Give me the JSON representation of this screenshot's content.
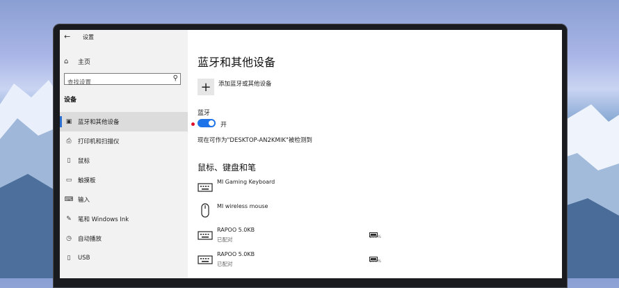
{
  "window": {
    "title": "设置"
  },
  "sidebar": {
    "home_label": "主页",
    "search_placeholder": "查找设置",
    "section_label": "设备",
    "items": [
      {
        "label": "蓝牙和其他设备",
        "icon": "bluetooth-devices-icon",
        "active": true
      },
      {
        "label": "打印机和扫描仪",
        "icon": "printer-icon",
        "active": false
      },
      {
        "label": "鼠标",
        "icon": "mouse-icon",
        "active": false
      },
      {
        "label": "触摸板",
        "icon": "touchpad-icon",
        "active": false
      },
      {
        "label": "输入",
        "icon": "keyboard-icon",
        "active": false
      },
      {
        "label": "笔和 Windows Ink",
        "icon": "pen-icon",
        "active": false
      },
      {
        "label": "自动播放",
        "icon": "autoplay-icon",
        "active": false
      },
      {
        "label": "USB",
        "icon": "usb-icon",
        "active": false
      }
    ]
  },
  "main": {
    "title": "蓝牙和其他设备",
    "add_device_label": "添加蓝牙或其他设备",
    "bluetooth_label": "蓝牙",
    "bluetooth_toggle_text": "开",
    "discoverable_text": "现在可作为\"DESKTOP-AN2KMIK\"被检测到",
    "section_title": "鼠标、键盘和笔",
    "devices": [
      {
        "name": "MI Gaming Keyboard",
        "status": "",
        "battery": "",
        "icon": "keyboard-icon"
      },
      {
        "name": "MI wireless mouse",
        "status": "",
        "battery": "",
        "icon": "mouse-icon"
      },
      {
        "name": "RAPOO 5.0KB",
        "status": "已配对",
        "battery": "100%",
        "icon": "keyboard-icon"
      },
      {
        "name": "RAPOO 5.0KB",
        "status": "已配对",
        "battery": "100%",
        "icon": "keyboard-icon"
      }
    ]
  },
  "colors": {
    "accent": "#1e73e8",
    "sidebar_bg": "#f2f2f2",
    "active_bg": "#dcdcdc",
    "alert_dot": "#e0102a"
  }
}
